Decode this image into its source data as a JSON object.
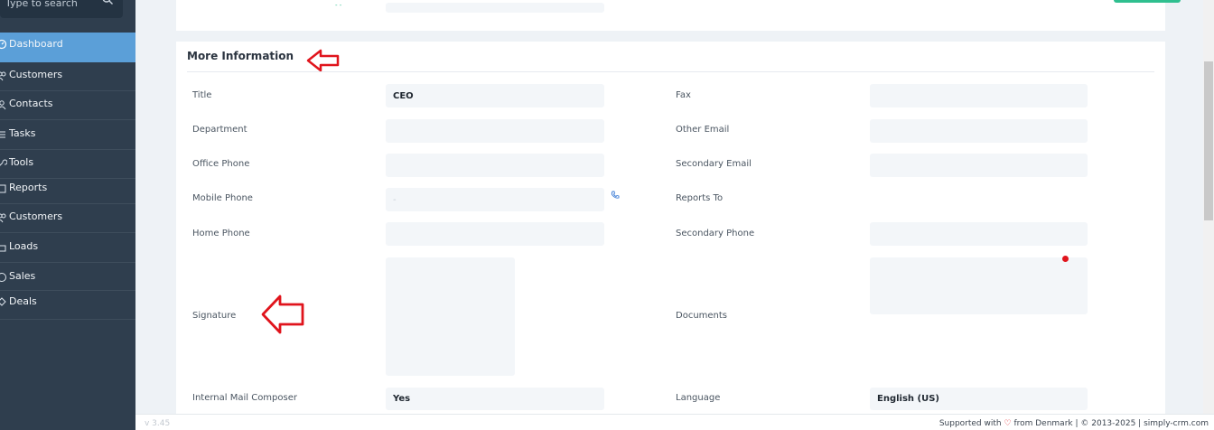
{
  "sidebar": {
    "search_placeholder": "Type to search",
    "items": [
      {
        "label": "Dashboard",
        "icon": "dashboard-icon",
        "active": true
      },
      {
        "label": "Customers",
        "icon": "customers-icon"
      },
      {
        "label": "Contacts",
        "icon": "contacts-icon"
      },
      {
        "label": "Tasks",
        "icon": "tasks-icon"
      },
      {
        "label": "Tools",
        "icon": "tools-icon"
      },
      {
        "label": "Reports",
        "icon": "reports-icon"
      },
      {
        "label": "Customers",
        "icon": "customers-icon"
      },
      {
        "label": "Loads",
        "icon": "loads-icon"
      },
      {
        "label": "Sales",
        "icon": "sales-icon"
      },
      {
        "label": "Deals",
        "icon": "deals-icon"
      }
    ]
  },
  "section": {
    "title": "More Information",
    "fields": {
      "title": {
        "label": "Title",
        "value": "CEO"
      },
      "department": {
        "label": "Department",
        "value": ""
      },
      "office_phone": {
        "label": "Office Phone",
        "value": ""
      },
      "mobile_phone": {
        "label": "Mobile Phone",
        "value": "-"
      },
      "home_phone": {
        "label": "Home Phone",
        "value": ""
      },
      "signature": {
        "label": "Signature"
      },
      "internal_mail": {
        "label": "Internal Mail Composer",
        "value": "Yes"
      },
      "fax": {
        "label": "Fax",
        "value": ""
      },
      "other_email": {
        "label": "Other Email",
        "value": ""
      },
      "secondary_email": {
        "label": "Secondary Email",
        "value": ""
      },
      "reports_to": {
        "label": "Reports To"
      },
      "secondary_phone": {
        "label": "Secondary Phone",
        "value": ""
      },
      "documents": {
        "label": "Documents"
      },
      "language": {
        "label": "Language",
        "value": "English (US)"
      }
    }
  },
  "footer": {
    "version": "v 3.45",
    "supported_prefix": "Supported with",
    "supported_suffix": "from Denmark",
    "copyright": "© 2013-2025",
    "site": "simply-crm.com"
  },
  "colors": {
    "sidebar_bg": "#2f3e4e",
    "active_item": "#5b9fd8",
    "annotation_red": "#e0141c",
    "accent_green": "#2fbf8f"
  }
}
